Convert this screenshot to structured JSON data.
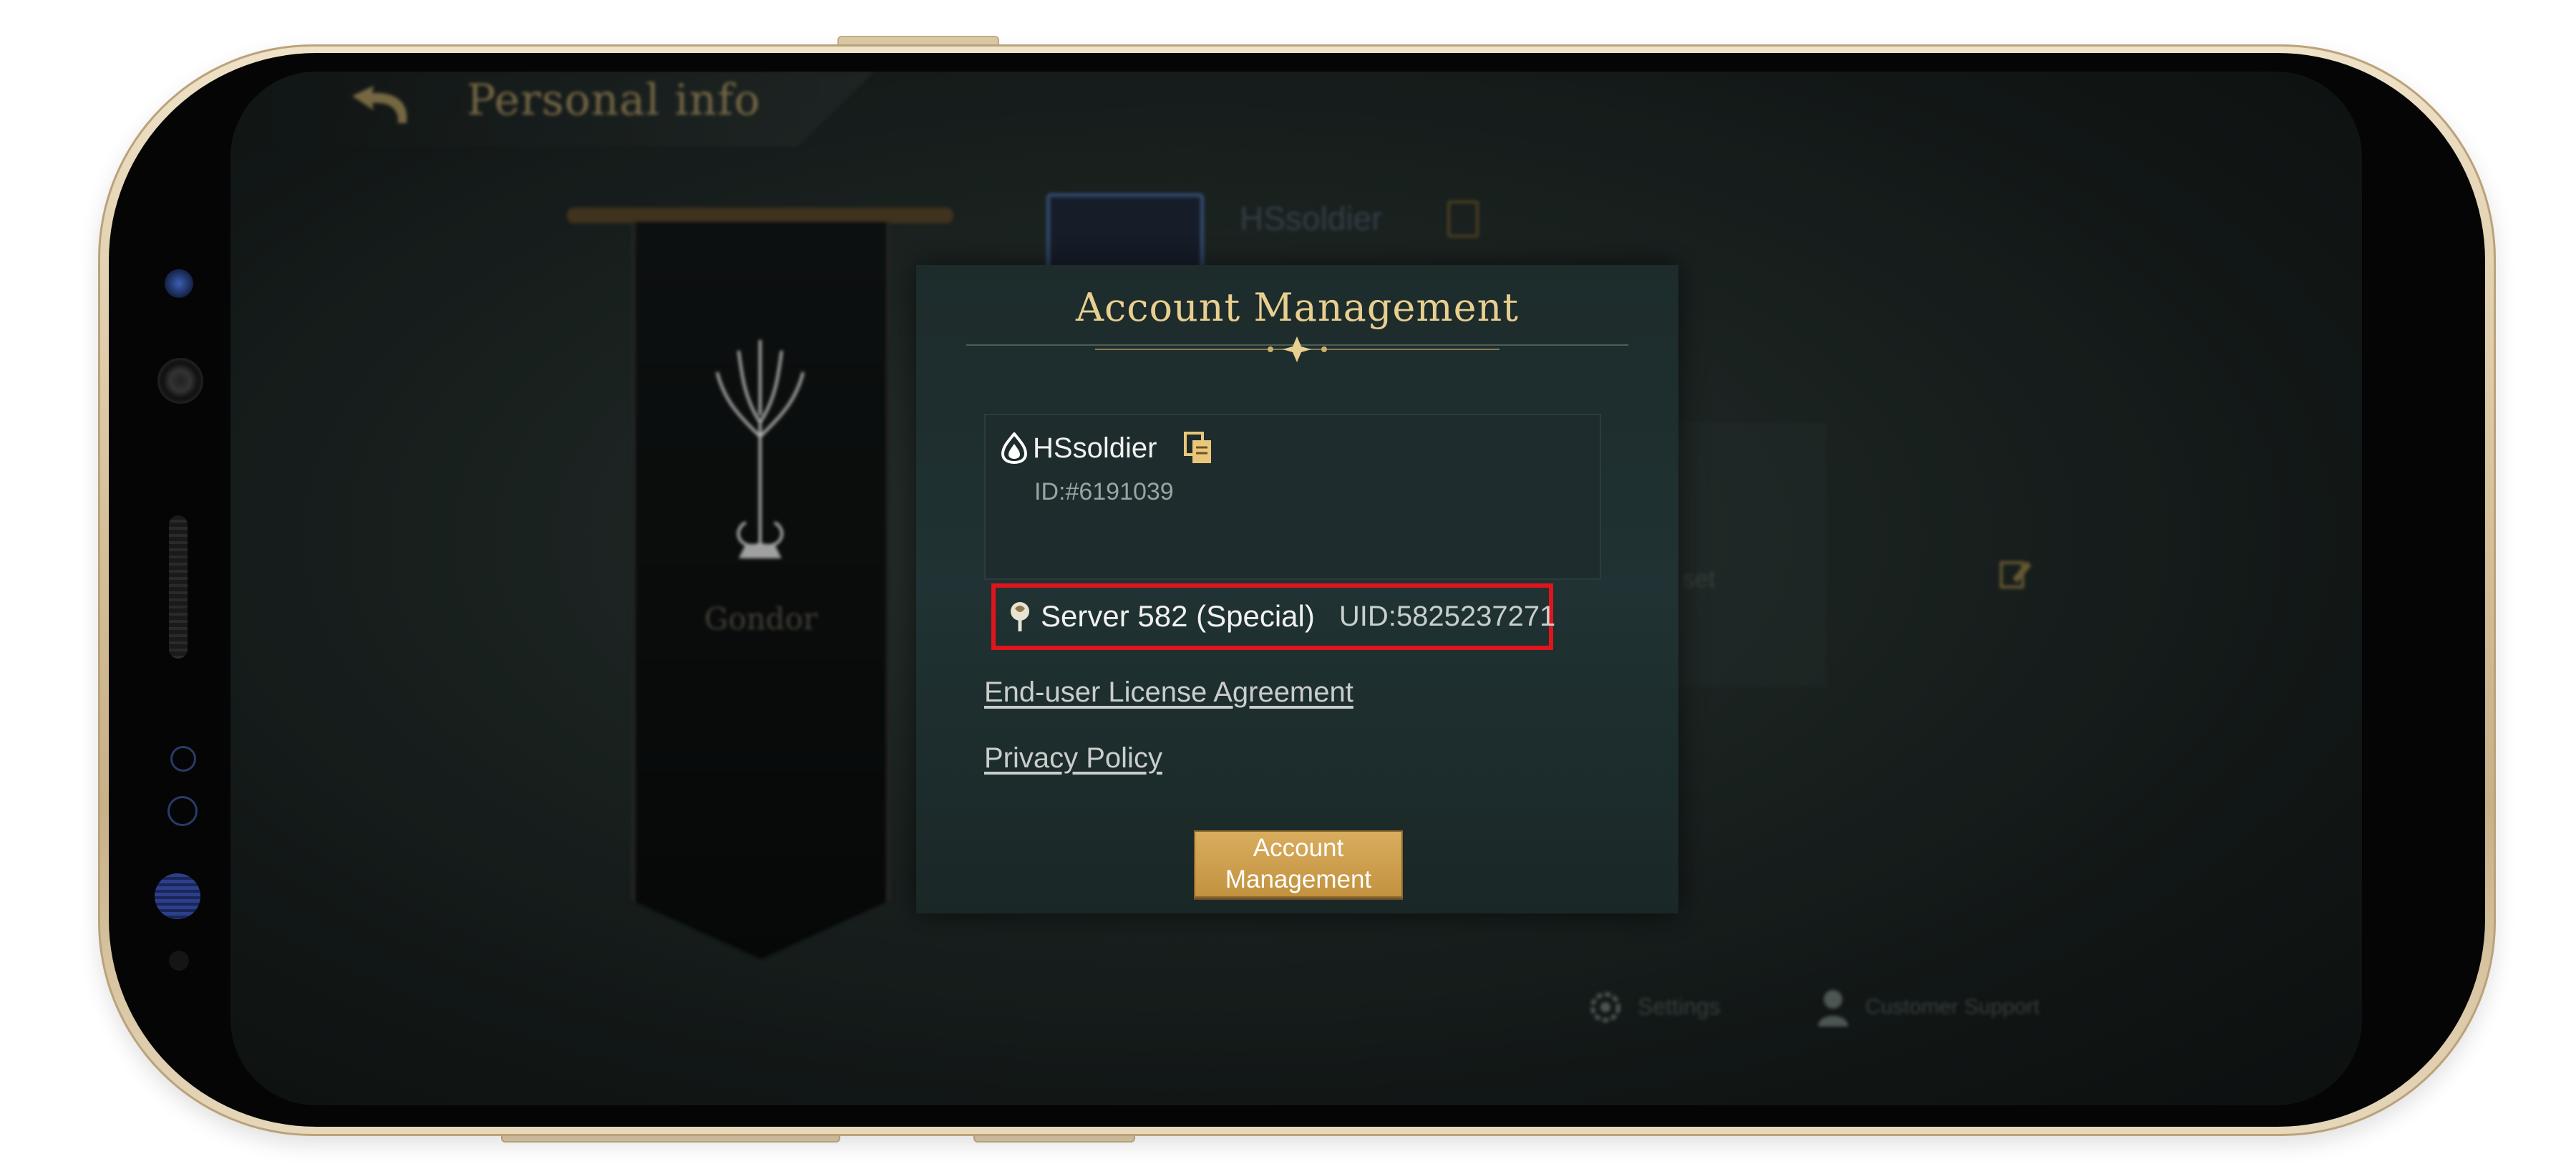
{
  "background": {
    "page_title": "Personal info",
    "player_name": "HSsoldier",
    "banner_label": "Gondor",
    "settings_label": "Settings",
    "support_label": "Customer Support",
    "set_label": "t set"
  },
  "dialog": {
    "title": "Account Management",
    "username": "HSsoldier",
    "user_id": "ID:#6191039",
    "server_name": "Server 582 (Special)",
    "uid": "UID:5825237271",
    "eula_link": "End-user License Agreement",
    "privacy_link": "Privacy Policy",
    "account_button": "Account Management"
  },
  "colors": {
    "accent_gold": "#e9cf8f",
    "button_gold": "#d9ad5e",
    "highlight_red": "#e0141c",
    "dialog_bg": "#1d2b2b"
  },
  "icons": [
    "back-icon",
    "copy-icon",
    "user-icon",
    "server-icon",
    "settings-icon",
    "support-icon",
    "edit-icon",
    "tree-emblem-icon"
  ]
}
